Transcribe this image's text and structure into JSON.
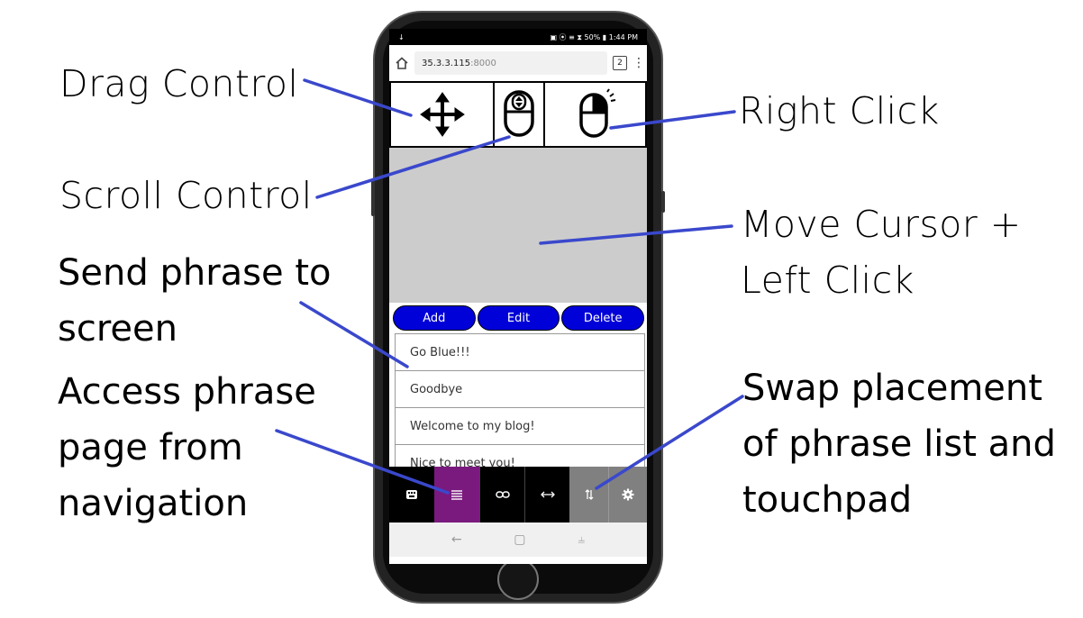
{
  "status_bar": {
    "left_icon": "↓",
    "right_text": "▣ ⦿ ≡ ⧗ 50% ▮ 1:44 PM"
  },
  "browser": {
    "url_host": "35.3.3.115",
    "url_port": ":8000",
    "tab_count": "2",
    "menu_glyph": "⋮"
  },
  "controls": {
    "drag_icon": "move-arrows-icon",
    "scroll_icon": "mouse-scroll-icon",
    "right_click_icon": "mouse-right-click-icon"
  },
  "phrases": {
    "buttons": {
      "add": "Add",
      "edit": "Edit",
      "delete": "Delete"
    },
    "items": [
      "Go Blue!!!",
      "Goodbye",
      "Welcome to my blog!",
      "Nice to meet you!"
    ]
  },
  "nav": [
    {
      "icon": "keyboard-icon",
      "bg": "#000000"
    },
    {
      "icon": "list-icon",
      "bg": "#7a1a7e"
    },
    {
      "icon": "link-icon",
      "bg": "#000000"
    },
    {
      "icon": "swap-horizontal-icon",
      "bg": "#000000"
    },
    {
      "icon": "swap-vertical-icon",
      "bg": "#808080"
    },
    {
      "icon": "gear-icon",
      "bg": "#808080"
    }
  ],
  "android_nav": {
    "back": "←",
    "home": "▢",
    "recents": "⫨"
  },
  "callouts": {
    "drag_control": "Drag Control",
    "scroll_control": "Scroll Control",
    "right_click": "Right Click",
    "move_cursor": [
      "Move Cursor +",
      "Left Click"
    ],
    "send_phrase": [
      "Send phrase to",
      "screen"
    ],
    "access_phrase": [
      "Access phrase",
      "page from",
      "navigation"
    ],
    "swap_placement": [
      "Swap placement",
      "of phrase list and",
      "touchpad"
    ]
  },
  "colors": {
    "leader_line": "#3a48cc",
    "button_blue": "#0000d8",
    "touchpad_gray": "#cccccc",
    "nav_active": "#7a1a7e"
  }
}
